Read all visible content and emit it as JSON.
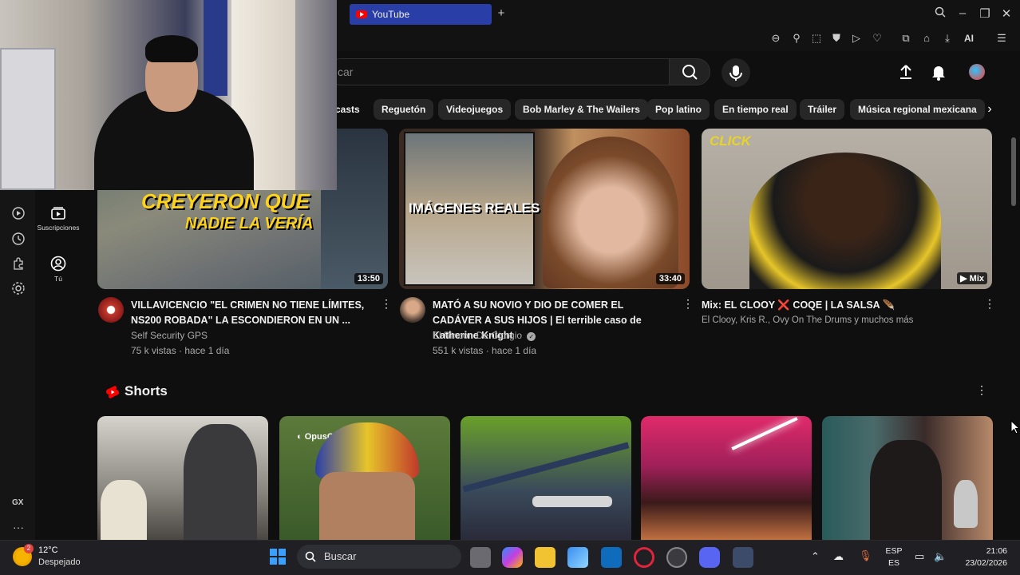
{
  "browser": {
    "tab_label": "YouTube",
    "ai_label": "AI"
  },
  "header": {
    "search_placeholder_visible": "car"
  },
  "chips": [
    "casts",
    "Reguetón",
    "Videojuegos",
    "Bob Marley & The Wailers",
    "Pop latino",
    "En tiempo real",
    "Tráiler",
    "Música regional mexicana"
  ],
  "sidebar": {
    "items": [
      {
        "label": "Suscripciones"
      },
      {
        "label": "Tú"
      }
    ],
    "gx_label": "GX"
  },
  "videos": [
    {
      "thumb_text_line1": "CREYERON QUE",
      "thumb_text_line2": "NADIE LA VERÍA",
      "duration": "13:50",
      "title": "VILLAVICENCIO \"EL CRIMEN NO TIENE LÍMITES, NS200 ROBADA\" LA ESCONDIERON EN UN ...",
      "channel": "Self Security GPS",
      "stats": "75 k vistas · hace 1 día"
    },
    {
      "thumb_text": "IMÁGENES REALES",
      "duration": "33:40",
      "title": "MATÓ A SU NOVIO Y DIO DE COMER EL CADÁVER A SUS HIJOS | El terrible caso de Katherine Knight",
      "channel": "El Rincón De Giorgio",
      "stats": "551 k vistas · hace 1 día"
    },
    {
      "thumb_brand": "CLICK",
      "badge": "Mix",
      "title": "Mix: EL CLOOY ❌ COQE | LA SALSA 🪶",
      "channel": "El Clooy, Kris R., Ovy On The Drums y muchos más"
    }
  ],
  "shorts": {
    "title": "Shorts",
    "opusclip_label": "OpusClip"
  },
  "taskbar": {
    "weather_badge": "2",
    "temperature": "12°C",
    "condition": "Despejado",
    "search_label": "Buscar",
    "lang_top": "ESP",
    "lang_bottom": "ES",
    "time": "21:06",
    "date": "23/02/2026"
  },
  "colors": {
    "accent_red": "#ff0000",
    "tab_blue": "#2a3ea8",
    "background": "#0f0f0f"
  }
}
